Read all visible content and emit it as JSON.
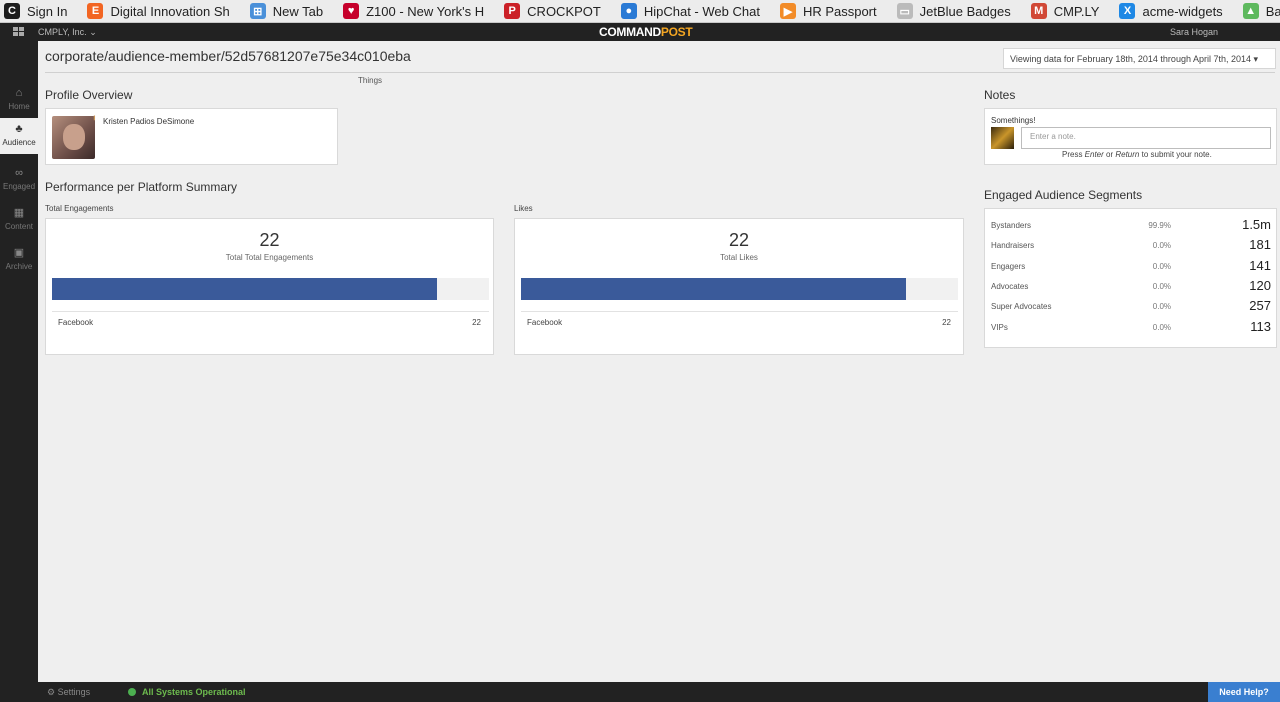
{
  "bookmarks": [
    {
      "label": "Sign In",
      "icon": "c-logo-icon",
      "color": "#1c1c1c",
      "glyph": "C"
    },
    {
      "label": "Digital Innovation Sh",
      "icon": "e-logo-icon",
      "color": "#f26522",
      "glyph": "E"
    },
    {
      "label": "New Tab",
      "icon": "new-tab-icon",
      "color": "#4a90d9",
      "glyph": "⊞"
    },
    {
      "label": "Z100 - New York's H",
      "icon": "iheart-icon",
      "color": "#c6002b",
      "glyph": "♥"
    },
    {
      "label": "CROCKPOT",
      "icon": "pinterest-icon",
      "color": "#cb2027",
      "glyph": "P"
    },
    {
      "label": "HipChat - Web Chat",
      "icon": "hipchat-icon",
      "color": "#2a7ad5",
      "glyph": "●"
    },
    {
      "label": "HR Passport",
      "icon": "arrow-icon",
      "color": "#f28c28",
      "glyph": "▶"
    },
    {
      "label": "JetBlue Badges",
      "icon": "page-icon",
      "color": "#bbbbbb",
      "glyph": "▭"
    },
    {
      "label": "CMP.LY",
      "icon": "gmail-icon",
      "color": "#d14836",
      "glyph": "M"
    },
    {
      "label": "acme-widgets",
      "icon": "x-logo-icon",
      "color": "#1e88e5",
      "glyph": "X"
    },
    {
      "label": "Basecamp Projects",
      "icon": "basecamp-icon",
      "color": "#5eb95e",
      "glyph": "▲"
    }
  ],
  "topbar": {
    "org": "CMPLY, Inc.  ⌄",
    "logo_main": "COMMAND",
    "logo_accent": "POST",
    "user": "Sara Hogan"
  },
  "nav": [
    {
      "label": "Home",
      "glyph": "⌂"
    },
    {
      "label": "Audience",
      "glyph": "♣"
    },
    {
      "label": "Engaged",
      "glyph": "∞"
    },
    {
      "label": "Content",
      "glyph": "▦"
    },
    {
      "label": "Archive",
      "glyph": "▣"
    }
  ],
  "page": {
    "title": "corporate/audience-member/52d57681207e75e34c010eba",
    "date_range": "Viewing data for February 18th, 2014 through April 7th, 2014  ▾",
    "things": "Things"
  },
  "profile": {
    "heading": "Profile Overview",
    "name": "Kristen Padios DeSimone"
  },
  "performance": {
    "heading": "Performance per Platform Summary",
    "cards": [
      {
        "sub": "Total Engagements",
        "value": "22",
        "label": "Total Total Engagements",
        "fill": 0.88,
        "platform": "Facebook",
        "platform_value": "22"
      },
      {
        "sub": "Likes",
        "value": "22",
        "label": "Total Likes",
        "fill": 0.88,
        "platform": "Facebook",
        "platform_value": "22"
      }
    ]
  },
  "notes": {
    "heading": "Notes",
    "label": "Somethings!",
    "placeholder": "Enter a note.",
    "hint_prefix": "Press ",
    "hint_enter": "Enter",
    "hint_or": " or ",
    "hint_return": "Return",
    "hint_suffix": " to submit your note."
  },
  "segments": {
    "heading": "Engaged Audience Segments",
    "rows": [
      {
        "name": "Bystanders",
        "pct": "99.9%",
        "count": "1.5m"
      },
      {
        "name": "Handraisers",
        "pct": "0.0%",
        "count": "181"
      },
      {
        "name": "Engagers",
        "pct": "0.0%",
        "count": "141"
      },
      {
        "name": "Advocates",
        "pct": "0.0%",
        "count": "120"
      },
      {
        "name": "Super Advocates",
        "pct": "0.0%",
        "count": "257"
      },
      {
        "name": "VIPs",
        "pct": "0.0%",
        "count": "113"
      }
    ]
  },
  "footer": {
    "settings": "⚙ Settings",
    "status": "All Systems Operational",
    "help": "Need Help?"
  }
}
